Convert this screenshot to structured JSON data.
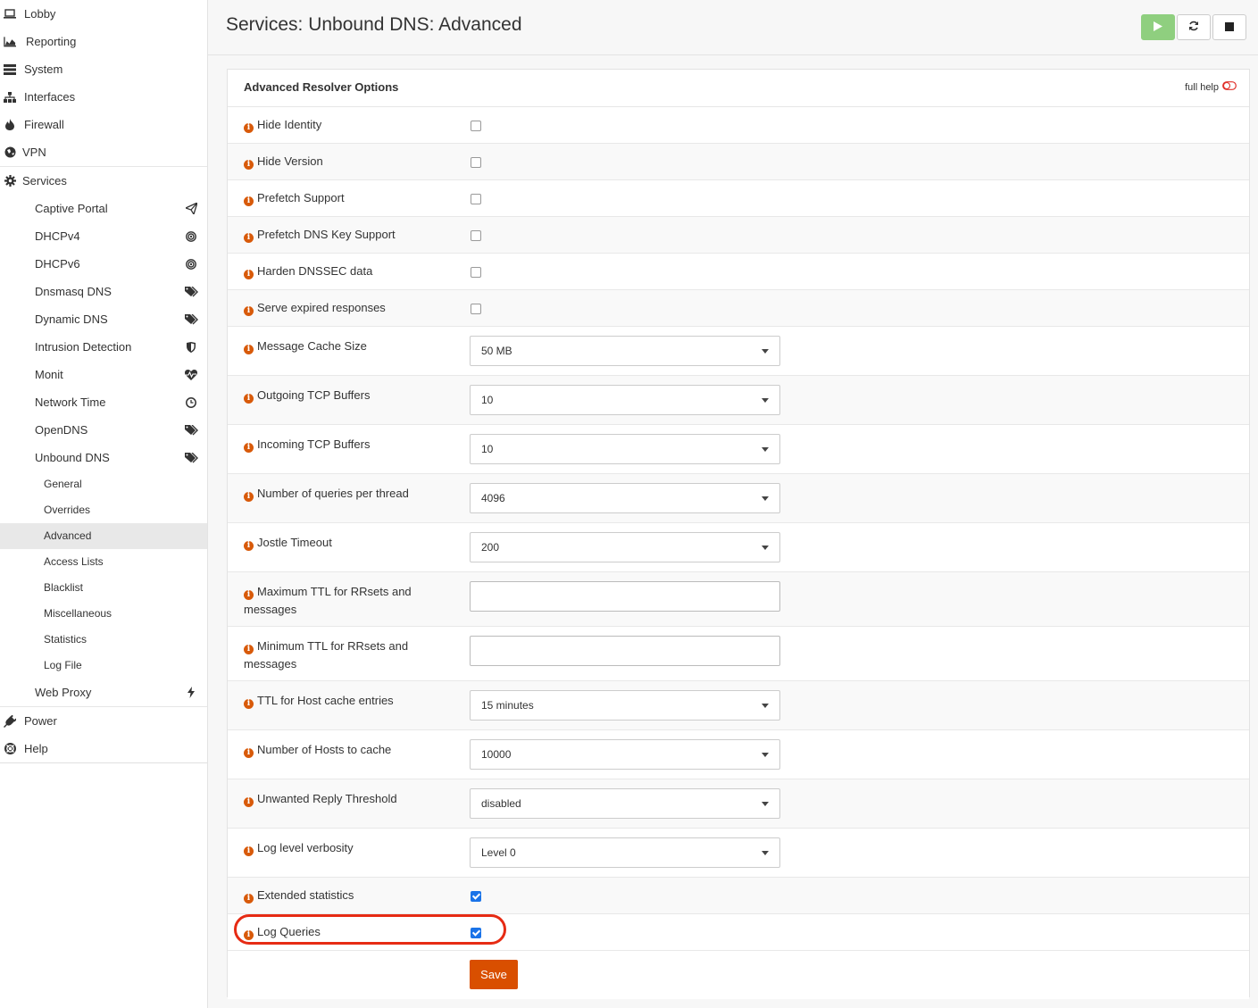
{
  "sidebar": {
    "items": [
      {
        "label": "Lobby",
        "icon": "laptop-icon"
      },
      {
        "label": "Reporting",
        "icon": "area-chart-icon"
      },
      {
        "label": "System",
        "icon": "server-icon"
      },
      {
        "label": "Interfaces",
        "icon": "sitemap-icon"
      },
      {
        "label": "Firewall",
        "icon": "fire-icon"
      },
      {
        "label": "VPN",
        "icon": "globe-icon"
      },
      {
        "label": "Services",
        "icon": "gear-icon"
      }
    ],
    "services": [
      {
        "label": "Captive Portal",
        "icon": "paper-plane-icon"
      },
      {
        "label": "DHCPv4",
        "icon": "bullseye-icon"
      },
      {
        "label": "DHCPv6",
        "icon": "bullseye-icon"
      },
      {
        "label": "Dnsmasq DNS",
        "icon": "tags-icon"
      },
      {
        "label": "Dynamic DNS",
        "icon": "tags-icon"
      },
      {
        "label": "Intrusion Detection",
        "icon": "shield-icon"
      },
      {
        "label": "Monit",
        "icon": "heartbeat-icon"
      },
      {
        "label": "Network Time",
        "icon": "clock-icon"
      },
      {
        "label": "OpenDNS",
        "icon": "tags-icon"
      },
      {
        "label": "Unbound DNS",
        "icon": "tags-icon"
      }
    ],
    "unbound": [
      {
        "label": "General"
      },
      {
        "label": "Overrides"
      },
      {
        "label": "Advanced"
      },
      {
        "label": "Access Lists"
      },
      {
        "label": "Blacklist"
      },
      {
        "label": "Miscellaneous"
      },
      {
        "label": "Statistics"
      },
      {
        "label": "Log File"
      }
    ],
    "web_proxy": {
      "label": "Web Proxy",
      "icon": "bolt-icon"
    },
    "power": {
      "label": "Power",
      "icon": "plug-icon"
    },
    "help": {
      "label": "Help",
      "icon": "life-ring-icon"
    }
  },
  "header": {
    "title": "Services: Unbound DNS: Advanced",
    "start_color": "#8fcf7f"
  },
  "panel": {
    "title": "Advanced Resolver Options",
    "full_help": "full help",
    "save_label": "Save",
    "rows": [
      {
        "label": "Hide Identity",
        "type": "checkbox",
        "checked": false
      },
      {
        "label": "Hide Version",
        "type": "checkbox",
        "checked": false
      },
      {
        "label": "Prefetch Support",
        "type": "checkbox",
        "checked": false
      },
      {
        "label": "Prefetch DNS Key Support",
        "type": "checkbox",
        "checked": false
      },
      {
        "label": "Harden DNSSEC data",
        "type": "checkbox",
        "checked": false
      },
      {
        "label": "Serve expired responses",
        "type": "checkbox",
        "checked": false
      },
      {
        "label": "Message Cache Size",
        "type": "select",
        "value": "50 MB"
      },
      {
        "label": "Outgoing TCP Buffers",
        "type": "select",
        "value": "10"
      },
      {
        "label": "Incoming TCP Buffers",
        "type": "select",
        "value": "10"
      },
      {
        "label": "Number of queries per thread",
        "type": "select",
        "value": "4096"
      },
      {
        "label": "Jostle Timeout",
        "type": "select",
        "value": "200"
      },
      {
        "label": "Maximum TTL for RRsets and messages",
        "type": "text",
        "value": ""
      },
      {
        "label": "Minimum TTL for RRsets and messages",
        "type": "text",
        "value": ""
      },
      {
        "label": "TTL for Host cache entries",
        "type": "select",
        "value": "15 minutes"
      },
      {
        "label": "Number of Hosts to cache",
        "type": "select",
        "value": "10000"
      },
      {
        "label": "Unwanted Reply Threshold",
        "type": "select",
        "value": "disabled"
      },
      {
        "label": "Log level verbosity",
        "type": "select",
        "value": "Level 0"
      },
      {
        "label": "Extended statistics",
        "type": "checkbox",
        "checked": true
      },
      {
        "label": "Log Queries",
        "type": "checkbox",
        "checked": true
      }
    ]
  }
}
